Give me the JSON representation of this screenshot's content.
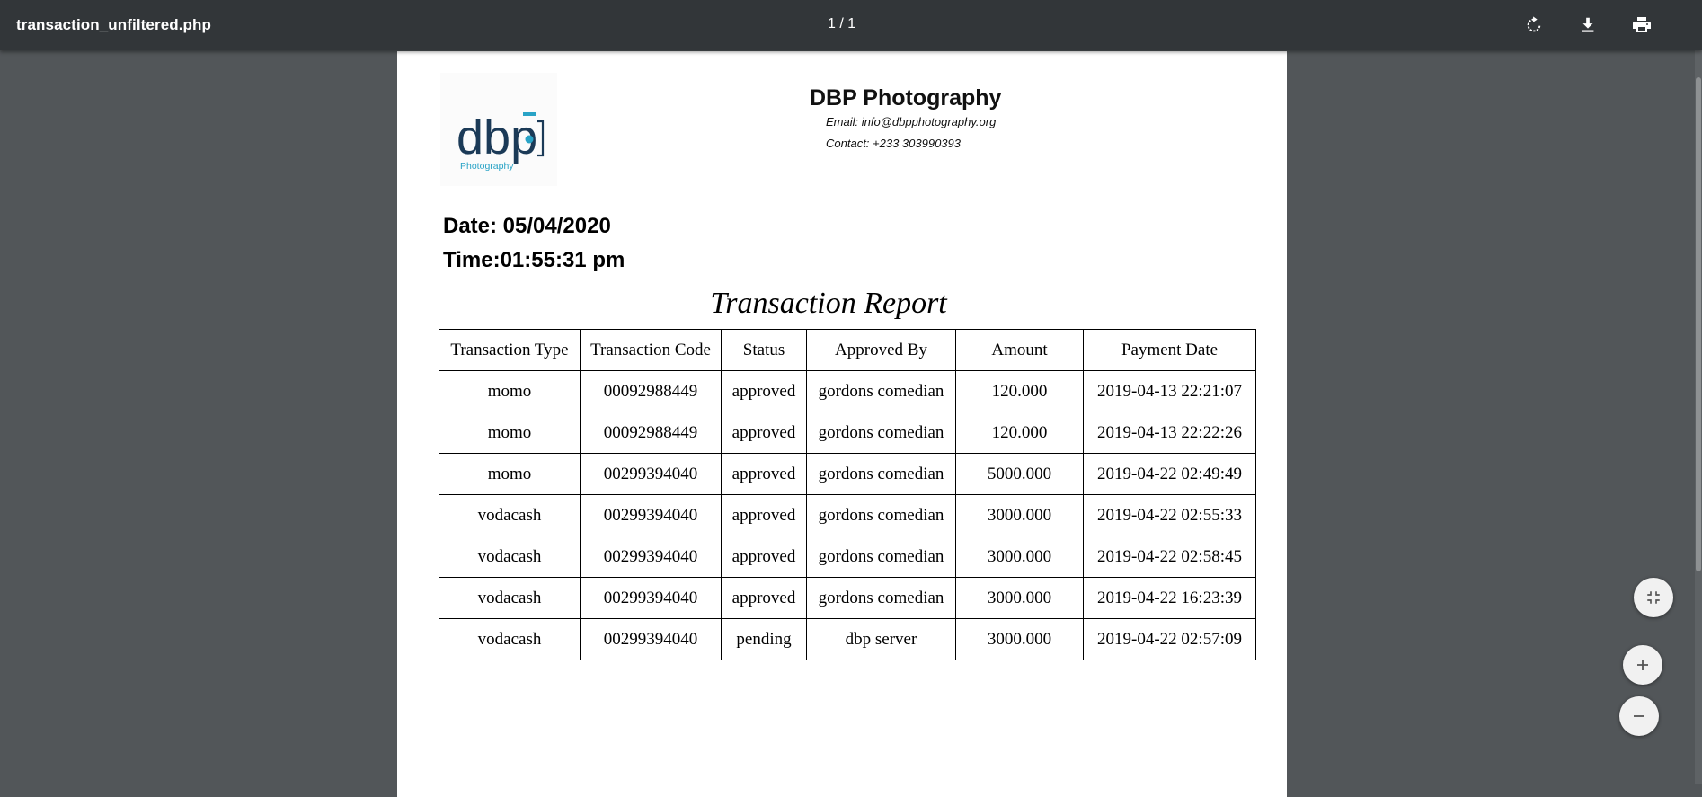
{
  "toolbar": {
    "file_name": "transaction_unfiltered.php",
    "page_indicator": "1 / 1",
    "rotate_icon": "rotate-clockwise-icon",
    "download_icon": "download-icon",
    "print_icon": "print-icon"
  },
  "controls": {
    "fit_icon": "fit-to-page-icon",
    "zoom_in_icon": "zoom-in-icon",
    "zoom_out_icon": "zoom-out-icon"
  },
  "document": {
    "logo": {
      "alt": "dbp Photography logo",
      "text": "dbp",
      "subtitle": "Photography",
      "colors": {
        "dark": "#1b3a57",
        "accent": "#29a3c6"
      }
    },
    "company": "DBP Photography",
    "email": "Email: info@dbpphotography.org",
    "contact": "Contact: +233 303990393",
    "date": "Date: 05/04/2020",
    "time": "Time:01:55:31 pm",
    "report_title": "Transaction Report",
    "table": {
      "headers": [
        "Transaction Type",
        "Transaction Code",
        "Status",
        "Approved By",
        "Amount",
        "Payment Date"
      ],
      "rows": [
        [
          "momo",
          "00092988449",
          "approved",
          "gordons comedian",
          "120.000",
          "2019-04-13 22:21:07"
        ],
        [
          "momo",
          "00092988449",
          "approved",
          "gordons comedian",
          "120.000",
          "2019-04-13 22:22:26"
        ],
        [
          "momo",
          "00299394040",
          "approved",
          "gordons comedian",
          "5000.000",
          "2019-04-22 02:49:49"
        ],
        [
          "vodacash",
          "00299394040",
          "approved",
          "gordons comedian",
          "3000.000",
          "2019-04-22 02:55:33"
        ],
        [
          "vodacash",
          "00299394040",
          "approved",
          "gordons comedian",
          "3000.000",
          "2019-04-22 02:58:45"
        ],
        [
          "vodacash",
          "00299394040",
          "approved",
          "gordons comedian",
          "3000.000",
          "2019-04-22 16:23:39"
        ],
        [
          "vodacash",
          "00299394040",
          "pending",
          "dbp server",
          "3000.000",
          "2019-04-22 02:57:09"
        ]
      ]
    }
  }
}
